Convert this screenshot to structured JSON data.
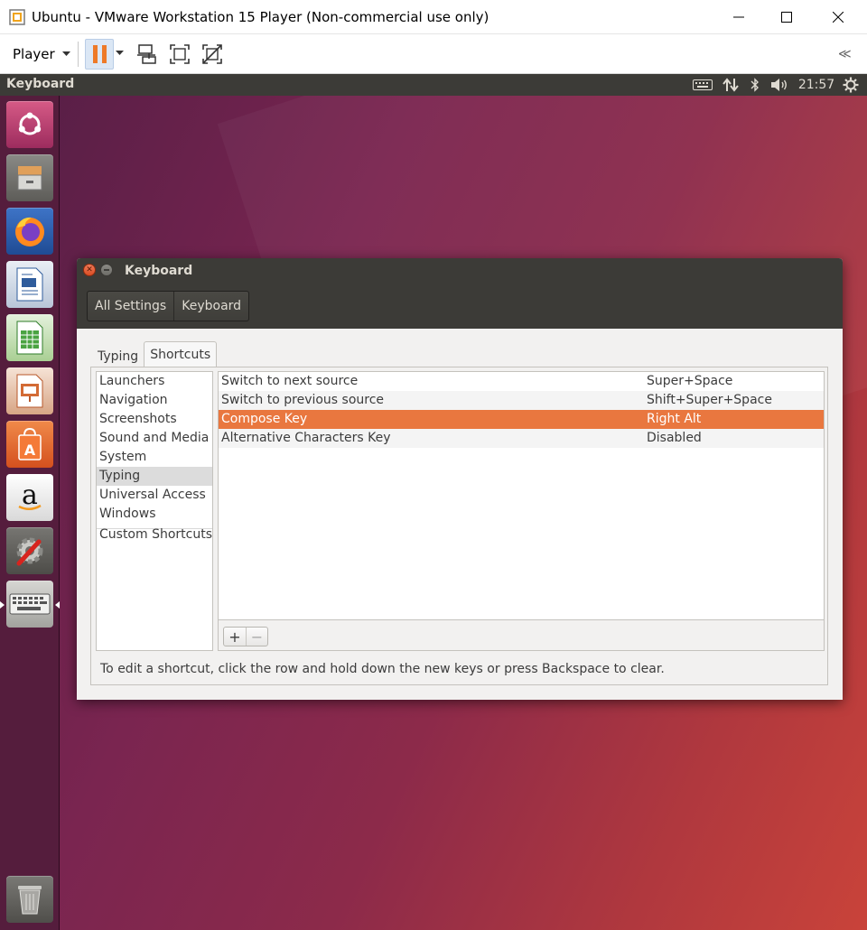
{
  "vmware": {
    "window_title": "Ubuntu - VMware Workstation 15 Player (Non-commercial use only)",
    "player_menu_label": "Player",
    "collapse_glyph": "≪"
  },
  "ubuntu_panel": {
    "app_title": "Keyboard",
    "clock": "21:57"
  },
  "launcher": {
    "items": [
      "ubuntu-dash",
      "files",
      "firefox",
      "libreoffice-writer",
      "libreoffice-calc",
      "libreoffice-impress",
      "ubuntu-software",
      "amazon",
      "system-settings",
      "keyboard-settings",
      "trash"
    ]
  },
  "dialog": {
    "title": "Keyboard",
    "breadcrumb": [
      "All Settings",
      "Keyboard"
    ],
    "tabs": [
      "Typing",
      "Shortcuts"
    ],
    "active_tab": "Shortcuts",
    "categories": [
      "Launchers",
      "Navigation",
      "Screenshots",
      "Sound and Media",
      "System",
      "Typing",
      "Universal Access",
      "Windows",
      "Custom Shortcuts"
    ],
    "selected_category": "Typing",
    "shortcuts": [
      {
        "name": "Switch to next source",
        "key": "Super+Space"
      },
      {
        "name": "Switch to previous source",
        "key": "Shift+Super+Space"
      },
      {
        "name": "Compose Key",
        "key": "Right Alt"
      },
      {
        "name": "Alternative Characters Key",
        "key": "Disabled"
      }
    ],
    "selected_shortcut": "Compose Key",
    "add_label": "+",
    "remove_label": "−",
    "hint": "To edit a shortcut, click the row and hold down the new keys or press Backspace to clear."
  },
  "colors": {
    "selection": "#e9773f",
    "panel": "#3c3b37",
    "pause_orange": "#ee7a28"
  }
}
